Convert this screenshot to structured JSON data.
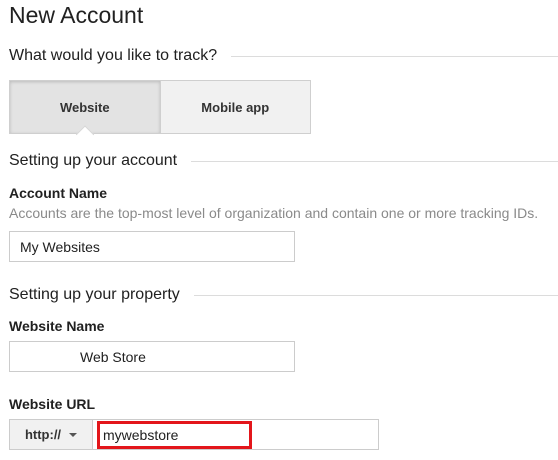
{
  "page": {
    "title": "New Account"
  },
  "track_section": {
    "heading": "What would you like to track?",
    "options": [
      {
        "label": "Website",
        "active": true
      },
      {
        "label": "Mobile app",
        "active": false
      }
    ]
  },
  "account_section": {
    "heading": "Setting up your account",
    "account_name_label": "Account Name",
    "account_name_help": "Accounts are the top-most level of organization and contain one or more tracking IDs.",
    "account_name_value": "My Websites"
  },
  "property_section": {
    "heading": "Setting up your property",
    "website_name_label": "Website Name",
    "website_name_value": "Web Store",
    "website_url_label": "Website URL",
    "protocol_value": "http://",
    "url_value": "mywebstore"
  },
  "colors": {
    "highlight_border": "#e3161b",
    "active_toggle_bg": "#e3e3e3"
  }
}
